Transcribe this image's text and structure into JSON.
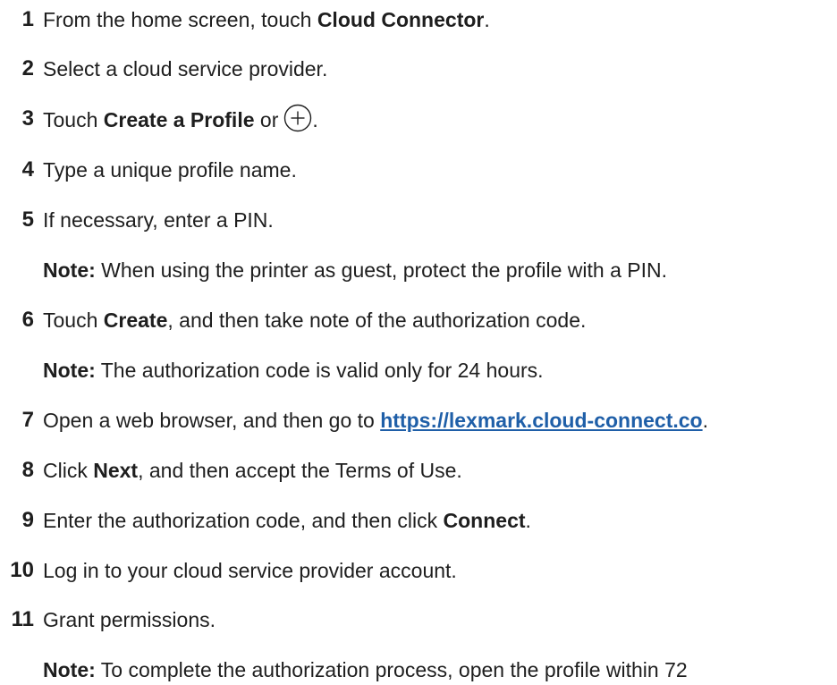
{
  "steps": [
    {
      "num": "1",
      "pre": "From the home screen, touch ",
      "bold": "Cloud Connector",
      "post": "."
    },
    {
      "num": "2",
      "text": "Select a cloud service provider."
    },
    {
      "num": "3",
      "pre": "Touch ",
      "bold": "Create a Profile",
      "post": " or",
      "end": ".",
      "icon": "plus-circle-icon"
    },
    {
      "num": "4",
      "text": "Type a unique profile name."
    },
    {
      "num": "5",
      "text": "If necessary, enter a PIN."
    },
    {
      "num": "6",
      "pre": "Touch ",
      "bold": "Create",
      "post": ", and then take note of the authorization code."
    },
    {
      "num": "7",
      "pre": "Open a web browser, and then go to ",
      "link": "https://lexmark.cloud-connect.co",
      "post": "."
    },
    {
      "num": "8",
      "pre": "Click ",
      "bold": "Next",
      "post": ", and then accept the Terms of Use."
    },
    {
      "num": "9",
      "pre": "Enter the authorization code, and then click ",
      "bold": "Connect",
      "post": "."
    },
    {
      "num": "10",
      "text": "Log in to your cloud service provider account."
    },
    {
      "num": "11",
      "text": "Grant permissions."
    }
  ],
  "notes": [
    {
      "label": "Note:",
      "text": " When using the printer as guest, protect the profile with a PIN."
    },
    {
      "label": "Note:",
      "text": " The authorization code is valid only for 24 hours."
    },
    {
      "label": "Note:",
      "text": " To complete the authorization process, open the profile within 72"
    }
  ]
}
